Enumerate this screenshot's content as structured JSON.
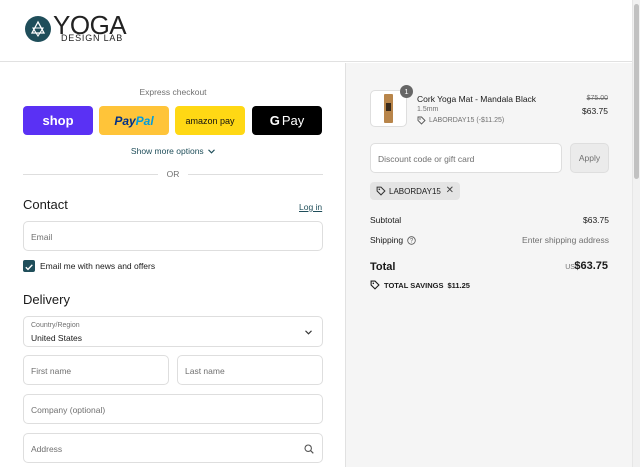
{
  "brand": {
    "name_big": "YOGA",
    "name_small": "DESIGN LAB"
  },
  "express": {
    "title": "Express checkout",
    "buttons": {
      "shop": "shop",
      "paypal_a": "Pay",
      "paypal_b": "Pal",
      "amazon": "amazon pay",
      "gpay_g": "G",
      "gpay_text": "Pay"
    },
    "more_options": "Show more options",
    "or": "OR"
  },
  "contact": {
    "heading": "Contact",
    "login": "Log in",
    "email_placeholder": "Email",
    "newsletter_label": "Email me with news and offers",
    "newsletter_checked": true
  },
  "delivery": {
    "heading": "Delivery",
    "country_label": "Country/Region",
    "country_value": "United States",
    "first_name_placeholder": "First name",
    "last_name_placeholder": "Last name",
    "company_placeholder": "Company (optional)",
    "address_placeholder": "Address"
  },
  "summary": {
    "item": {
      "quantity": "1",
      "name": "Cork Yoga Mat - Mandala Black",
      "variant": "1.5mm",
      "discount": "LABORDAY15 (-$11.25)",
      "original_price": "$75.00",
      "price": "$63.75"
    },
    "discount_placeholder": "Discount code or gift card",
    "apply_label": "Apply",
    "applied_code": "LABORDAY15",
    "subtotal_label": "Subtotal",
    "subtotal_value": "$63.75",
    "shipping_label": "Shipping",
    "shipping_value": "Enter shipping address",
    "total_label": "Total",
    "currency": "USD",
    "total_value": "$63.75",
    "savings_label": "TOTAL SAVINGS",
    "savings_value": "$11.25"
  },
  "colors": {
    "accent": "#1f4e5a",
    "shop": "#5a31f4",
    "paypal": "#ffc439",
    "amazon": "#ffd814",
    "gpay": "#000000"
  }
}
